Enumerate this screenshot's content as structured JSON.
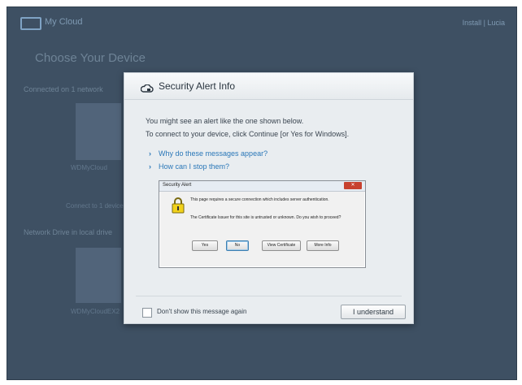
{
  "background": {
    "app_title": "My Cloud",
    "user_link": "Install | Lucia",
    "page_title": "Choose Your Device",
    "section_1": "Connected on 1 network",
    "section_2": "Network Drive in local drive",
    "device_1_caption": "WDMyCloud",
    "device_2_caption": "Connect to 1 device",
    "device_3_caption": "WDMyCloudEX2"
  },
  "modal": {
    "title": "Security Alert Info",
    "intro_1": "You might see an alert like the one shown below.",
    "intro_2": "To connect to your device, click Continue [or Yes for Windows].",
    "links": [
      {
        "label": "Why do these messages appear?"
      },
      {
        "label": "How can I stop them?"
      }
    ],
    "dont_show_label": "Don't show this message again",
    "understand_label": "I understand"
  },
  "alert": {
    "title": "Security Alert",
    "close_label": "✕",
    "message_1": "This page requires a secure connection which includes server authentication.",
    "message_2": "The Certificate Issuer for this site is untrusted or unknown.  Do you wish to proceed?",
    "buttons": {
      "yes": "Yes",
      "no": "No",
      "view": "View Certificate",
      "more": "More Info"
    }
  },
  "colors": {
    "overlay_bg": "#3e5063",
    "link": "#2a77b8",
    "modal_bg": "#e9edf0"
  }
}
